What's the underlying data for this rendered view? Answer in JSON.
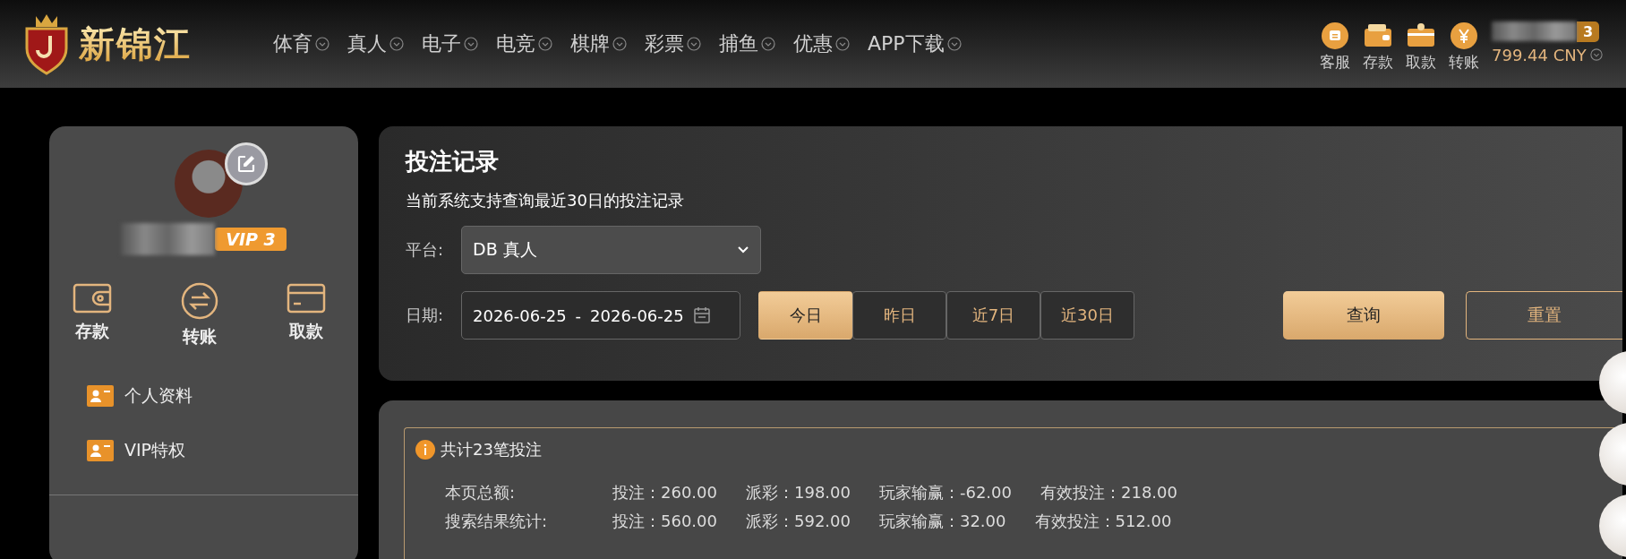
{
  "header": {
    "logo_text": "新锦江",
    "nav": [
      {
        "label": "体育"
      },
      {
        "label": "真人"
      },
      {
        "label": "电子"
      },
      {
        "label": "电竞"
      },
      {
        "label": "棋牌"
      },
      {
        "label": "彩票"
      },
      {
        "label": "捕鱼"
      },
      {
        "label": "优惠"
      },
      {
        "label": "APP下载"
      }
    ],
    "quick_actions": [
      {
        "kind": "service",
        "label": "客服"
      },
      {
        "kind": "deposit",
        "label": "存款"
      },
      {
        "kind": "withdraw",
        "label": "取款"
      },
      {
        "kind": "transfer",
        "label": "转账"
      }
    ],
    "vip_badge": "3",
    "balance": "799.44 CNY"
  },
  "profile": {
    "vip": "VIP 3",
    "actions": [
      {
        "kind": "deposit",
        "label": "存款"
      },
      {
        "kind": "transfer",
        "label": "转账"
      },
      {
        "kind": "withdraw",
        "label": "取款"
      }
    ],
    "menu": [
      {
        "label": "个人资料"
      },
      {
        "label": "VIP特权"
      }
    ]
  },
  "bet_records": {
    "title": "投注记录",
    "subtitle": "当前系统支持查询最近30日的投注记录",
    "platform_label": "平台:",
    "platform_value": "DB 真人",
    "date_label": "日期:",
    "date_start": "2026-06-25",
    "date_separator": "-",
    "date_end": "2026-06-25",
    "ranges": [
      {
        "label": "今日",
        "selected": true
      },
      {
        "label": "昨日",
        "selected": false
      },
      {
        "label": "近7日",
        "selected": false
      },
      {
        "label": "近30日",
        "selected": false
      }
    ],
    "search_button": "查询",
    "reset_button": "重置"
  },
  "summary": {
    "total": "共计23笔投注",
    "rows": [
      {
        "label": "本页总额:",
        "values": [
          "投注：260.00",
          "派彩：198.00",
          "玩家输赢：-62.00",
          "有效投注：218.00"
        ]
      },
      {
        "label": "搜索结果统计:",
        "values": [
          "投注：560.00",
          "派彩：592.00",
          "玩家输赢：32.00",
          "有效投注：512.00"
        ]
      }
    ]
  }
}
